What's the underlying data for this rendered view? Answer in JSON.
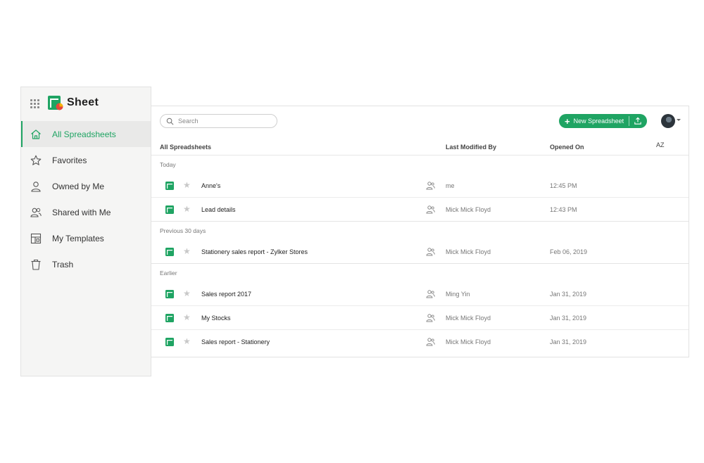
{
  "app": {
    "name": "Sheet"
  },
  "colors": {
    "accent": "#1fa463",
    "active_bg": "#e9e9e8"
  },
  "sidebar": {
    "items": [
      {
        "label": "All Spreadsheets",
        "icon": "home-icon",
        "active": true
      },
      {
        "label": "Favorites",
        "icon": "star-icon"
      },
      {
        "label": "Owned by Me",
        "icon": "user-icon"
      },
      {
        "label": "Shared with Me",
        "icon": "users-icon"
      },
      {
        "label": "My Templates",
        "icon": "templates-icon"
      },
      {
        "label": "Trash",
        "icon": "trash-icon"
      }
    ]
  },
  "toolbar": {
    "search_placeholder": "Search",
    "new_label": "New Spreadsheet"
  },
  "table": {
    "columns": [
      "All Spreadsheets",
      "Last Modified By",
      "Opened On"
    ],
    "sort_label": "AZ",
    "groups": [
      {
        "title": "Today",
        "rows": [
          {
            "name": "Anne's",
            "modified_by": "me",
            "opened": "12:45 PM"
          },
          {
            "name": "Lead details",
            "modified_by": "Mick Mick Floyd",
            "opened": "12:43 PM"
          }
        ]
      },
      {
        "title": "Previous 30 days",
        "rows": [
          {
            "name": "Stationery sales report - Zylker Stores",
            "modified_by": "Mick Mick Floyd",
            "opened": "Feb 06, 2019"
          }
        ]
      },
      {
        "title": "Earlier",
        "rows": [
          {
            "name": "Sales report 2017",
            "modified_by": "Ming Yin",
            "opened": "Jan 31, 2019"
          },
          {
            "name": "My Stocks",
            "modified_by": "Mick Mick Floyd",
            "opened": "Jan 31, 2019"
          },
          {
            "name": "Sales report - Stationery",
            "modified_by": "Mick Mick Floyd",
            "opened": "Jan 31, 2019"
          }
        ]
      }
    ]
  }
}
